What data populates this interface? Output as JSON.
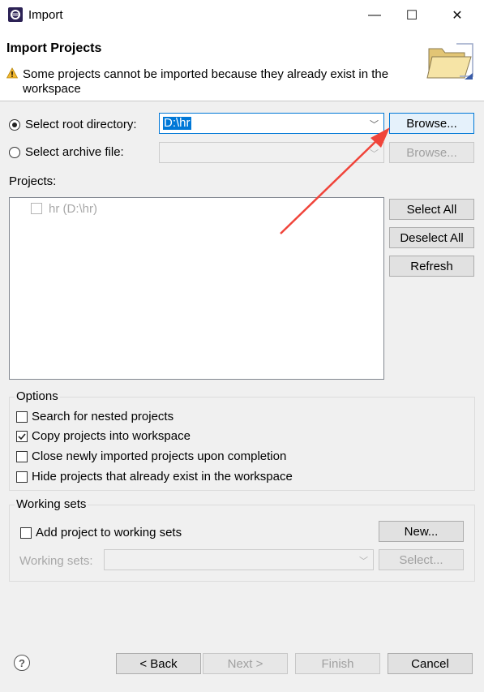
{
  "window": {
    "title": "Import",
    "controls": {
      "minimize": "—",
      "maximize": "☐",
      "close": "✕"
    }
  },
  "header": {
    "heading": "Import Projects",
    "message": "Some projects cannot be imported because they already exist in the workspace"
  },
  "source": {
    "root_label": "Select root directory:",
    "root_value": "D:\\hr",
    "root_selected": true,
    "archive_label": "Select archive file:",
    "archive_value": "",
    "browse_label": "Browse...",
    "browse_archive_label": "Browse..."
  },
  "projects": {
    "label": "Projects:",
    "items": [
      {
        "label": "hr (D:\\hr)",
        "checked": false,
        "enabled": false
      }
    ],
    "select_all": "Select All",
    "deselect_all": "Deselect All",
    "refresh": "Refresh"
  },
  "options": {
    "title": "Options",
    "items": [
      {
        "label": "Search for nested projects",
        "checked": false
      },
      {
        "label": "Copy projects into workspace",
        "checked": true
      },
      {
        "label": "Close newly imported projects upon completion",
        "checked": false
      },
      {
        "label": "Hide projects that already exist in the workspace",
        "checked": false
      }
    ]
  },
  "working_sets": {
    "title": "Working sets",
    "add_label": "Add project to working sets",
    "add_checked": false,
    "new_button": "New...",
    "sets_label": "Working sets:",
    "sets_value": "",
    "select_button": "Select..."
  },
  "footer": {
    "help_icon": "?",
    "back": "< Back",
    "next": "Next >",
    "finish": "Finish",
    "cancel": "Cancel"
  },
  "colors": {
    "annotation_arrow": "#f0443a",
    "focus_border": "#0078d7",
    "selection": "#0078d7"
  }
}
